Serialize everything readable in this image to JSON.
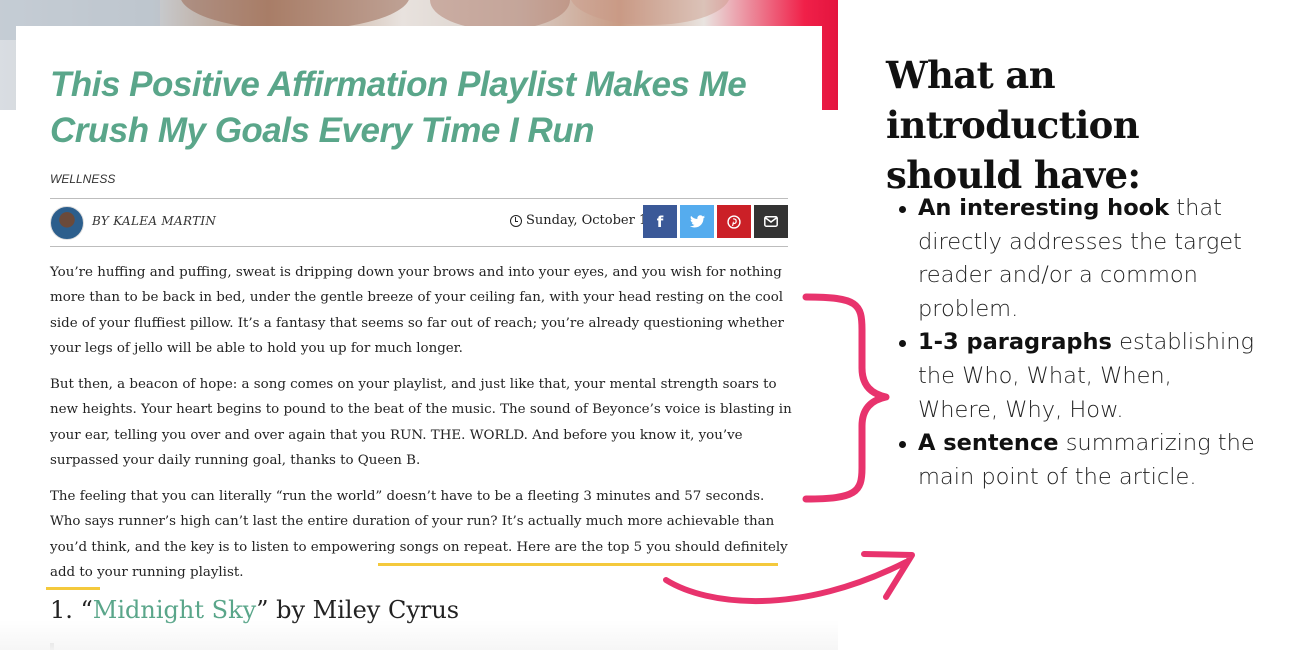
{
  "article": {
    "title": "This Positive Affirmation Playlist Makes Me Crush My Goals Every Time I Run",
    "category": "WELLNESS",
    "byline": "BY KALEA MARTIN",
    "date": "Sunday, October 18",
    "share": {
      "facebook": "f",
      "twitter": "t",
      "pinterest": "p",
      "email": "✉"
    },
    "paragraph1": "You’re huffing and puffing, sweat is dripping down your brows and into your eyes, and you wish for nothing more than to be back in bed, under the gentle breeze of your ceiling fan, with your head resting on the cool side of your fluffiest pillow. It’s a fantasy that seems so far out of reach; you’re already questioning whether your legs of jello will be able to hold you up for much longer.",
    "paragraph2": "But then, a beacon of hope: a song comes on your playlist, and just like that, your mental strength soars to new heights. Your heart begins to pound to the beat of the music. The sound of Beyonce’s voice is blasting in your ear, telling you over and over again that you RUN. THE. WORLD. And before you know it, you’ve surpassed your daily running goal, thanks to Queen B.",
    "paragraph3": "The feeling that you can literally “run the world” doesn’t have to be a fleeting 3 minutes and 57 seconds. Who says runner’s high can’t last the entire duration of your run? It’s actually much more achievable than you’d think, and the key is to listen to empowering songs on repeat. Here are the top 5 you should definitely add to your running playlist.",
    "song_number": "1. “",
    "song_title": "Midnight Sky",
    "song_suffix": "” by Miley Cyrus"
  },
  "panel": {
    "heading": "What an introduction should have:",
    "items": [
      {
        "bold": "An interesting hook",
        "rest": " that directly addresses the target reader and/or a common problem."
      },
      {
        "bold": "1-3 paragraphs",
        "rest": " establishing the Who, What, When, Where, Why, How."
      },
      {
        "bold": "A sentence",
        "rest": " summarizing the main point of the article."
      }
    ]
  },
  "colors": {
    "title_green": "#5aa68a",
    "annotation_pink": "#e8336d",
    "highlight_yellow": "#f4c93c"
  },
  "icons": [
    "clock-icon",
    "facebook-icon",
    "twitter-icon",
    "pinterest-icon",
    "email-icon",
    "curly-brace",
    "curved-arrow"
  ]
}
